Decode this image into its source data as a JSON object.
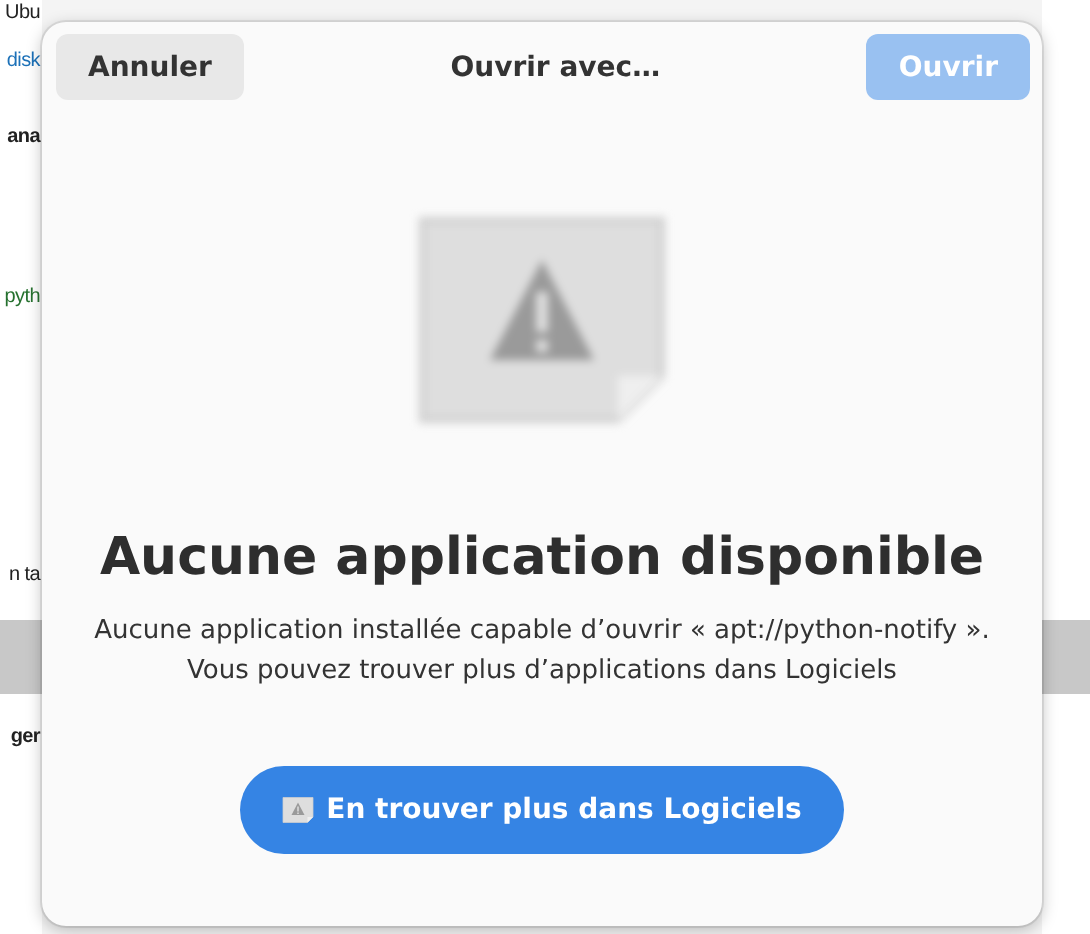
{
  "background": {
    "fragments": [
      {
        "text": "Ubu",
        "kind": "plain"
      },
      {
        "text": "disk",
        "kind": "link"
      },
      {
        "text": "ana",
        "kind": "bold"
      },
      {
        "text": "pyth",
        "kind": "green"
      },
      {
        "text": "n ta",
        "kind": "plain"
      },
      {
        "text": "ger",
        "kind": "bold"
      }
    ]
  },
  "dialog": {
    "cancel_button": "Annuler",
    "title": "Ouvrir avec…",
    "open_button": {
      "label": "Ouvrir",
      "disabled": true
    },
    "heading": "Aucune application disponible",
    "message": [
      "Aucune application installée capable d’ouvrir « apt://python-notify ».",
      "Vous pouvez trouver plus d’applications dans Logiciels"
    ],
    "action_button": "En trouver plus dans Logiciels"
  }
}
